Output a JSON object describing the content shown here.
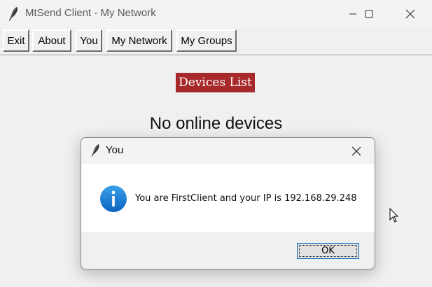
{
  "window": {
    "title": "MtSend Client - My Network",
    "controls": [
      "minimize-icon",
      "maximize-icon",
      "close-icon"
    ]
  },
  "menu": {
    "items": [
      {
        "label": "Exit"
      },
      {
        "label": "About"
      },
      {
        "label": "You"
      },
      {
        "label": "My Network"
      },
      {
        "label": "My Groups"
      }
    ]
  },
  "main": {
    "devices_list_label": "Devices List",
    "status_text": "No online devices"
  },
  "dialog": {
    "title": "You",
    "message": "You are FirstClient and your IP is 192.168.29.248",
    "ok_label": "OK",
    "icon": "info-icon"
  },
  "colors": {
    "devices_list_bg": "#a8292b",
    "info_icon": "#1a7fd4",
    "ok_border": "#0067c0"
  }
}
